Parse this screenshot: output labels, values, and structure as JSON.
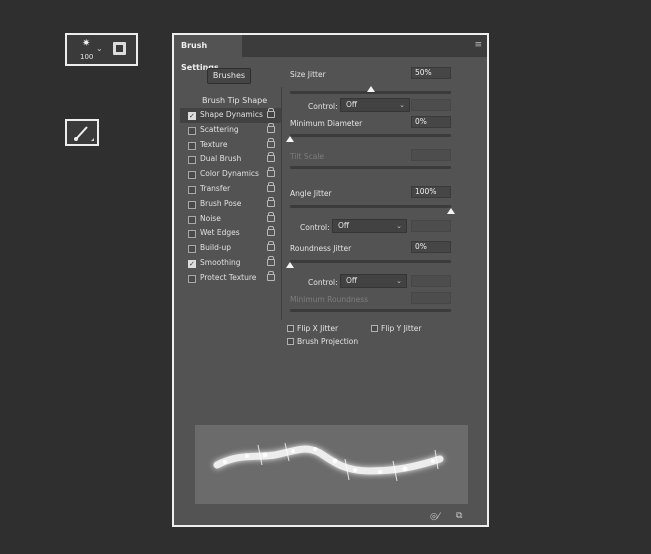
{
  "tool_options": {
    "preset_size": "100",
    "preset_icon": "brush-preset-star-icon",
    "brush_tool_icon": "paintbrush-icon"
  },
  "panel": {
    "title": "Brush Settings",
    "menu_icon": "panel-menu-icon",
    "brushes_button": "Brushes",
    "tip_shape_label": "Brush Tip Shape",
    "options": [
      {
        "label": "Shape Dynamics",
        "checked": true,
        "active": true
      },
      {
        "label": "Scattering",
        "checked": false
      },
      {
        "label": "Texture",
        "checked": false
      },
      {
        "label": "Dual Brush",
        "checked": false
      },
      {
        "label": "Color Dynamics",
        "checked": false
      },
      {
        "label": "Transfer",
        "checked": false
      },
      {
        "label": "Brush Pose",
        "checked": false
      },
      {
        "label": "Noise",
        "checked": false
      },
      {
        "label": "Wet Edges",
        "checked": false
      },
      {
        "label": "Build-up",
        "checked": false
      },
      {
        "label": "Smoothing",
        "checked": true
      },
      {
        "label": "Protect Texture",
        "checked": false
      }
    ],
    "settings": {
      "size_jitter_label": "Size Jitter",
      "size_jitter_value": "50%",
      "size_jitter_level": 0.5,
      "control_label": "Control:",
      "size_control_value": "Off",
      "min_diameter_label": "Minimum Diameter",
      "min_diameter_value": "0%",
      "min_diameter_level": 0,
      "tilt_scale_label": "Tilt Scale",
      "angle_jitter_label": "Angle Jitter",
      "angle_jitter_value": "100%",
      "angle_jitter_level": 1,
      "angle_control_value": "Off",
      "roundness_jitter_label": "Roundness Jitter",
      "roundness_jitter_value": "0%",
      "roundness_jitter_level": 0,
      "roundness_control_value": "Off",
      "min_roundness_label": "Minimum Roundness",
      "flip_x_label": "Flip X Jitter",
      "flip_y_label": "Flip Y Jitter",
      "projection_label": "Brush Projection"
    },
    "footer": {
      "toggle_icon": "eye-brush-icon",
      "new_icon": "new-preset-icon"
    }
  },
  "colors": {
    "background": "#2f2f2f",
    "panel": "#535353",
    "preview": "#6b6b6b"
  }
}
